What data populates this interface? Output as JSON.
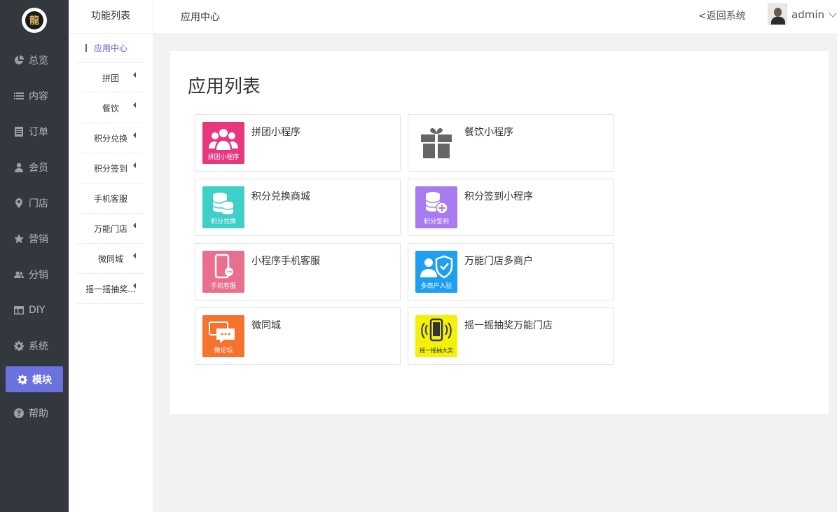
{
  "sidebar": {
    "logo_char": "龍",
    "items": [
      {
        "label": "总览",
        "icon": "pie-chart-icon"
      },
      {
        "label": "内容",
        "icon": "list-icon"
      },
      {
        "label": "订单",
        "icon": "order-icon"
      },
      {
        "label": "会员",
        "icon": "user-icon"
      },
      {
        "label": "门店",
        "icon": "map-pin-icon"
      },
      {
        "label": "营销",
        "icon": "star-icon"
      },
      {
        "label": "分销",
        "icon": "users-icon"
      },
      {
        "label": "DIY",
        "icon": "layout-icon"
      },
      {
        "label": "系统",
        "icon": "gear-icon"
      },
      {
        "label": "模块",
        "icon": "gear-icon"
      },
      {
        "label": "帮助",
        "icon": "help-icon"
      }
    ],
    "active_index": 9
  },
  "submenu": {
    "title": "功能列表",
    "items": [
      {
        "label": "应用中心",
        "has_caret": false
      },
      {
        "label": "拼团",
        "has_caret": true
      },
      {
        "label": "餐饮",
        "has_caret": true
      },
      {
        "label": "积分兑换",
        "has_caret": true
      },
      {
        "label": "积分签到",
        "has_caret": true
      },
      {
        "label": "手机客服",
        "has_caret": false
      },
      {
        "label": "万能门店",
        "has_caret": true
      },
      {
        "label": "微同城",
        "has_caret": true
      },
      {
        "label": "摇一摇抽奖...",
        "has_caret": true
      }
    ]
  },
  "header": {
    "breadcrumb": "应用中心",
    "back_label": "<返回系统",
    "username": "admin"
  },
  "main": {
    "title": "应用列表",
    "apps": [
      {
        "name": "拼团小程序",
        "badge": "拼团小程序",
        "color": "#e8367f",
        "icon": "group-icon"
      },
      {
        "name": "餐饮小程序",
        "badge": "",
        "color": "#ffffff",
        "icon": "gift-icon"
      },
      {
        "name": "积分兑换商城",
        "badge": "积分兑换",
        "color": "#3fcfc9",
        "icon": "coins-icon"
      },
      {
        "name": "积分签到小程序",
        "badge": "积分签到",
        "color": "#a87bf0",
        "icon": "coins-plus-icon"
      },
      {
        "name": "小程序手机客服",
        "badge": "手机客服",
        "color": "#ea6f8e",
        "icon": "phone-chat-icon"
      },
      {
        "name": "万能门店多商户",
        "badge": "多商户入驻",
        "color": "#1e9ff2",
        "icon": "merchant-shield-icon"
      },
      {
        "name": "微同城",
        "badge": "微论坛",
        "color": "#f5732d",
        "icon": "chat-bubbles-icon"
      },
      {
        "name": "摇一摇抽奖万能门店",
        "badge": "摇一摇抽大奖",
        "color": "#f3f10a",
        "icon": "shake-phone-icon"
      }
    ]
  }
}
